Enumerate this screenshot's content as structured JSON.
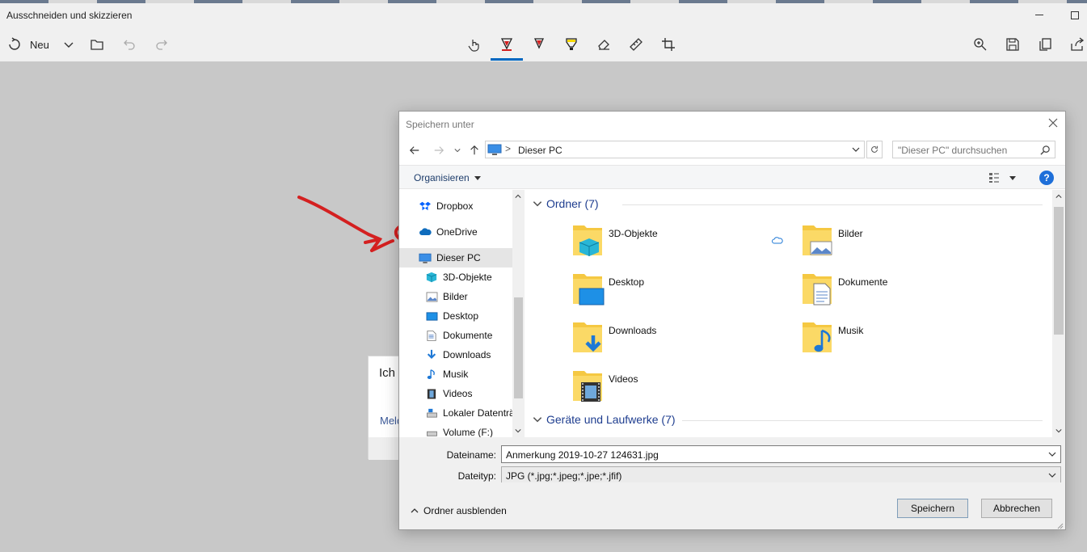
{
  "app": {
    "title": "Ausschneiden und skizzieren",
    "toolbar": {
      "new_label": "Neu"
    }
  },
  "background_card": {
    "line1": "Ich l",
    "link": "Meld"
  },
  "dialog": {
    "title": "Speichern unter",
    "address": {
      "path": "Dieser PC",
      "separator": ">"
    },
    "search": {
      "placeholder": "\"Dieser PC\" durchsuchen"
    },
    "command_bar": {
      "organize_label": "Organisieren",
      "help_label": "?"
    },
    "nav_pane": {
      "items": [
        {
          "label": "Dropbox",
          "icon": "dropbox-icon"
        },
        {
          "label": "OneDrive",
          "icon": "onedrive-cloud-icon"
        },
        {
          "label": "Dieser PC",
          "icon": "computer-icon",
          "selected": true
        },
        {
          "label": "3D-Objekte",
          "icon": "3d-objects-icon"
        },
        {
          "label": "Bilder",
          "icon": "pictures-icon"
        },
        {
          "label": "Desktop",
          "icon": "desktop-icon"
        },
        {
          "label": "Dokumente",
          "icon": "documents-icon"
        },
        {
          "label": "Downloads",
          "icon": "downloads-icon"
        },
        {
          "label": "Musik",
          "icon": "music-icon"
        },
        {
          "label": "Videos",
          "icon": "videos-icon"
        },
        {
          "label": "Lokaler Datenträ",
          "icon": "local-disk-icon"
        },
        {
          "label": "Volume (F:)",
          "icon": "volume-icon"
        }
      ]
    },
    "content": {
      "folders_group": "Ordner (7)",
      "devices_group": "Geräte und Laufwerke (7)",
      "folders": [
        {
          "label": "3D-Objekte",
          "icon": "3d-objects-folder-icon"
        },
        {
          "label": "Bilder",
          "icon": "pictures-folder-icon"
        },
        {
          "label": "Desktop",
          "icon": "desktop-folder-icon"
        },
        {
          "label": "Dokumente",
          "icon": "documents-folder-icon"
        },
        {
          "label": "Downloads",
          "icon": "downloads-folder-icon"
        },
        {
          "label": "Musik",
          "icon": "music-folder-icon"
        },
        {
          "label": "Videos",
          "icon": "videos-folder-icon"
        }
      ]
    },
    "fields": {
      "filename_label": "Dateiname:",
      "filename_value": "Anmerkung 2019-10-27 124631.jpg",
      "filetype_label": "Dateityp:",
      "filetype_value": "JPG (*.jpg;*.jpeg;*.jpe;*.jfif)"
    },
    "footer": {
      "hide_folders_label": "Ordner ausblenden",
      "save_label": "Speichern",
      "cancel_label": "Abbrechen"
    }
  },
  "colors": {
    "accent": "#0067c0",
    "annotation_red": "#d42020",
    "folder_yellow": "#f5c842",
    "group_header": "#1e3d8f"
  }
}
